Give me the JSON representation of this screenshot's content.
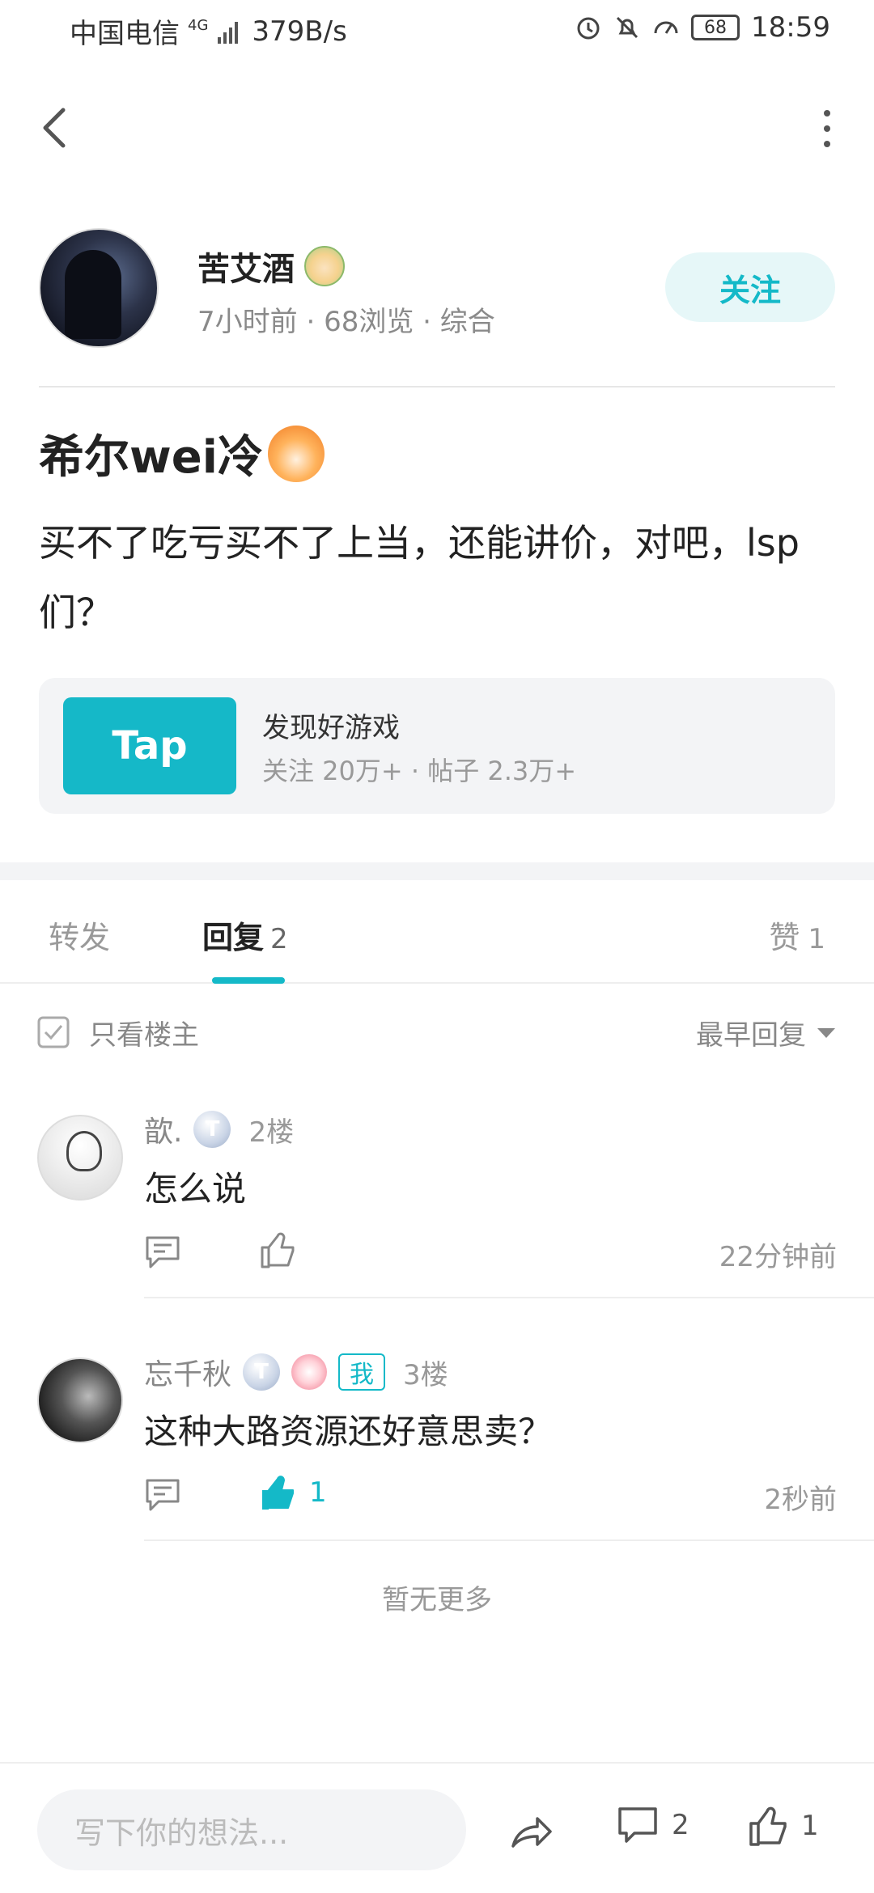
{
  "status_bar": {
    "carrier": "中国电信",
    "network": "4G",
    "speed": "379B/s",
    "battery": "68",
    "time": "18:59"
  },
  "author": {
    "name": "苦艾酒",
    "time": "7小时前",
    "views": "68浏览",
    "category": "综合",
    "follow_label": "关注"
  },
  "post": {
    "title": "希尔wei冷",
    "body": "买不了吃亏买不了上当，还能讲价，对吧，lsp们？"
  },
  "topic": {
    "logo_text": "Tap",
    "title": "发现好游戏",
    "stats": "关注 20万+ · 帖子 2.3万+"
  },
  "tabs": {
    "forward": "转发",
    "reply": "回复",
    "reply_count": "2",
    "like": "赞",
    "like_count": "1"
  },
  "filter": {
    "only_author": "只看楼主",
    "sort": "最早回复"
  },
  "comments": [
    {
      "name": "歆.",
      "level": "T",
      "floor": "2楼",
      "text": "怎么说",
      "likes": "",
      "time": "22分钟前"
    },
    {
      "name": "忘千秋",
      "level": "T",
      "me_tag": "我",
      "floor": "3楼",
      "text": "这种大路资源还好意思卖？",
      "likes": "1",
      "time": "2秒前"
    }
  ],
  "no_more": "暂无更多",
  "bottom_bar": {
    "input_placeholder": "写下你的想法...",
    "comment_count": "2",
    "like_count": "1"
  },
  "colors": {
    "accent": "#14b9c8",
    "tap_brand": "#15b8c8"
  }
}
